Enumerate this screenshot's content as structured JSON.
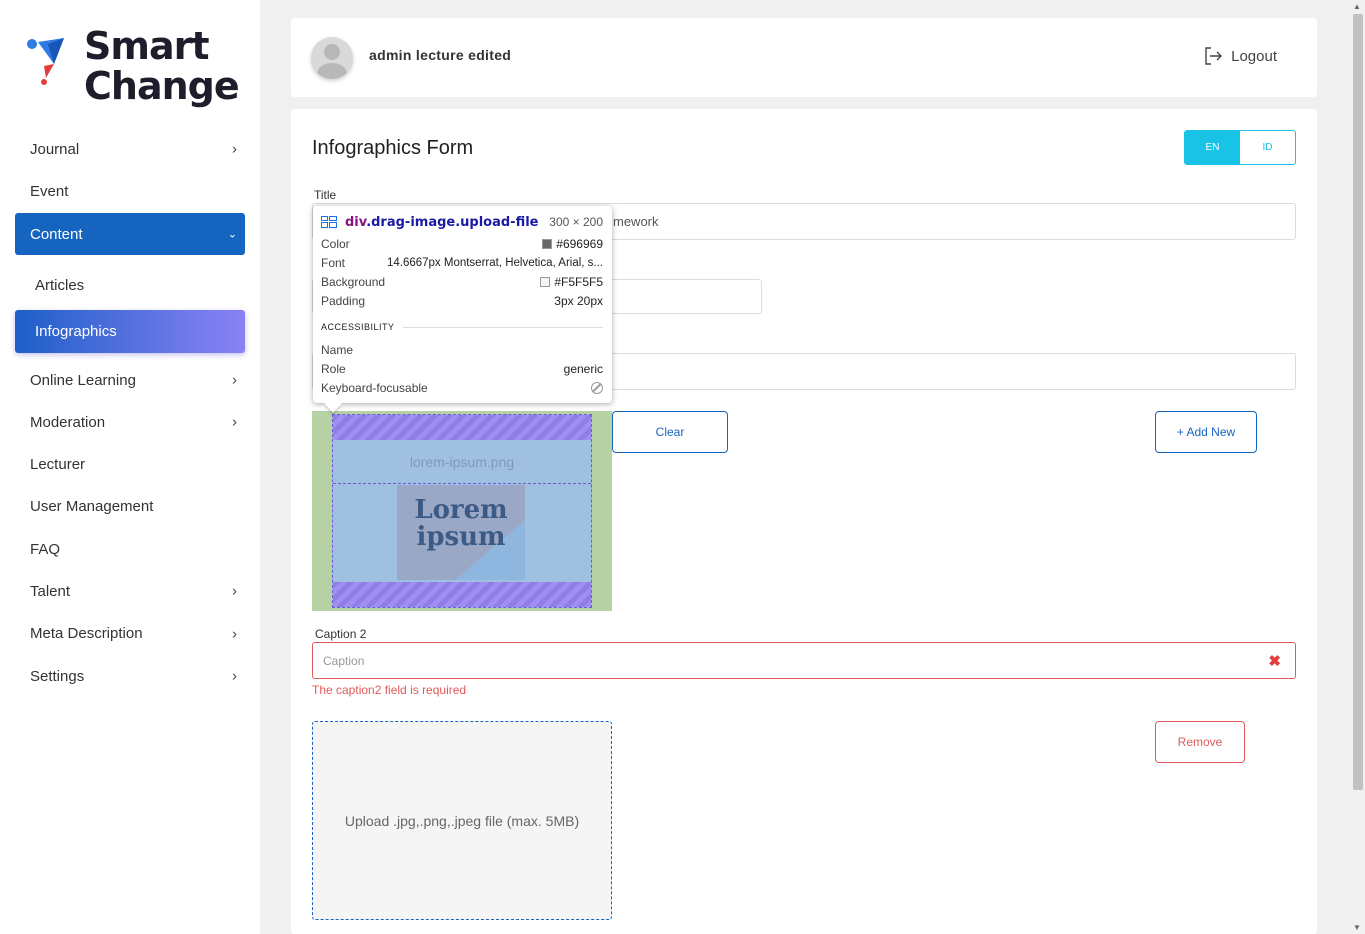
{
  "brand": {
    "line1": "Smart",
    "line2": "Change"
  },
  "sidebar": {
    "items": [
      {
        "label": "Journal",
        "chevron": ">"
      },
      {
        "label": "Event"
      },
      {
        "label": "Content",
        "chevron": "v"
      },
      {
        "label": "Articles"
      },
      {
        "label": "Infographics"
      },
      {
        "label": "Online Learning",
        "chevron": ">"
      },
      {
        "label": "Moderation",
        "chevron": ">"
      },
      {
        "label": "Lecturer"
      },
      {
        "label": "User Management"
      },
      {
        "label": "FAQ"
      },
      {
        "label": "Talent",
        "chevron": ">"
      },
      {
        "label": "Meta Description",
        "chevron": ">"
      },
      {
        "label": "Settings",
        "chevron": ">"
      }
    ]
  },
  "header": {
    "username": "admin lecture edited",
    "logout_label": "Logout"
  },
  "form": {
    "title": "Infographics Form",
    "lang": {
      "en": "EN",
      "id": "ID"
    },
    "title_label": "Title",
    "title_value_visible": "mework",
    "upload": {
      "file_name": "lorem-ipsum.png",
      "preview_text": "Lorem ipsum",
      "clear_label": "Clear",
      "add_new_label": "+ Add New"
    },
    "caption2": {
      "label": "Caption 2",
      "placeholder": "Caption",
      "error": "The caption2 field is required",
      "error_icon": "✖"
    },
    "upload2": {
      "hint": "Upload .jpg,.png,.jpeg file (max. 5MB)",
      "remove_label": "Remove"
    }
  },
  "devtools_tooltip": {
    "selector_tag": "div",
    "selector_class": ".drag-image.upload-file",
    "dimensions": "300 × 200",
    "color_label": "Color",
    "color_value": "#696969",
    "font_label": "Font",
    "font_value": "14.6667px Montserrat, Helvetica, Arial, s...",
    "background_label": "Background",
    "background_value": "#F5F5F5",
    "padding_label": "Padding",
    "padding_value": "3px 20px",
    "section": "ACCESSIBILITY",
    "name_label": "Name",
    "name_value": "",
    "role_label": "Role",
    "role_value": "generic",
    "focusable_label": "Keyboard-focusable"
  },
  "colors": {
    "primary": "#1565c0",
    "accent": "#19c3e6",
    "danger": "#e05a5a",
    "sidebar_active_gradient_end": "#8a82f5"
  }
}
